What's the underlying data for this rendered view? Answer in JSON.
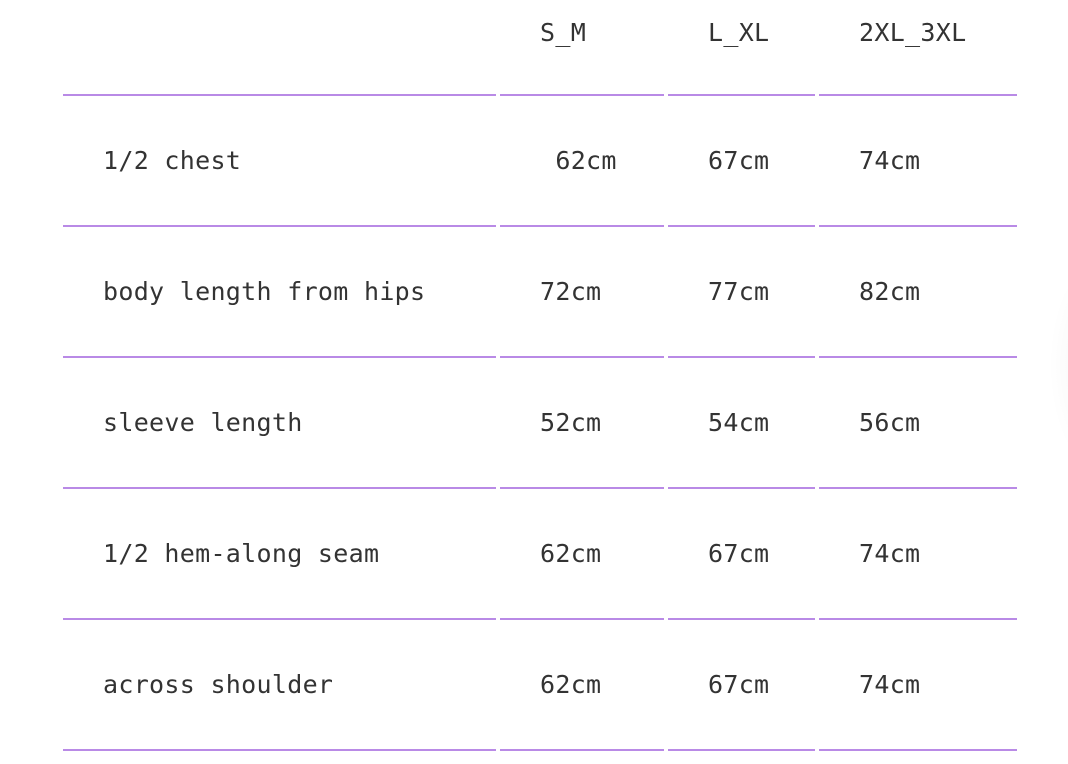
{
  "size_chart": {
    "columns": [
      "",
      "S_M",
      "L_XL",
      "2XL_3XL"
    ],
    "rows": [
      {
        "label": "1/2 chest",
        "values": [
          " 62cm",
          "67cm",
          "74cm"
        ]
      },
      {
        "label": "body length from hips",
        "values": [
          "72cm",
          "77cm",
          "82cm"
        ]
      },
      {
        "label": "sleeve length",
        "values": [
          "52cm",
          "54cm",
          "56cm"
        ]
      },
      {
        "label": "1/2 hem-along seam",
        "values": [
          "62cm",
          "67cm",
          "74cm"
        ]
      },
      {
        "label": "across shoulder",
        "values": [
          "62cm",
          "67cm",
          "74cm"
        ]
      }
    ]
  },
  "colors": {
    "divider": "#b98ae6",
    "text": "#333333"
  }
}
